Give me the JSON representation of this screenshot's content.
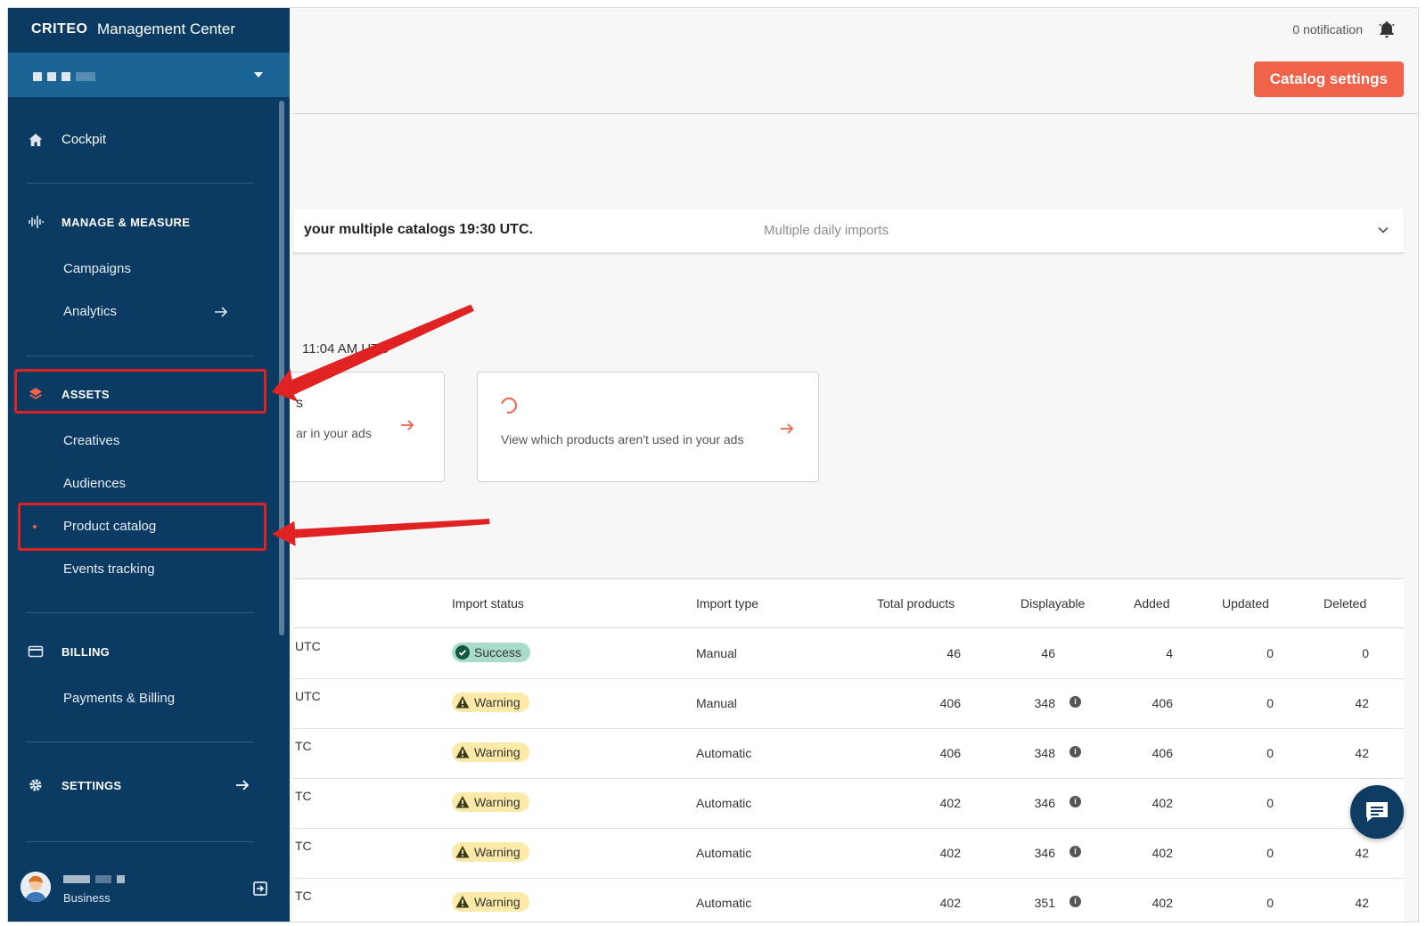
{
  "brand": {
    "logo": "CRITEO",
    "title": "Management Center"
  },
  "header": {
    "notifications": "0 notification",
    "catalog_settings": "Catalog settings"
  },
  "info_bar": {
    "text": "your multiple catalogs 19:30 UTC.",
    "subtext": "Multiple daily imports"
  },
  "time_label": "11:04 AM UTC",
  "cards": [
    {
      "title_fragment": "s",
      "text": "ar in your ads"
    },
    {
      "text": "View which products aren't used in your ads"
    }
  ],
  "sidebar": {
    "cockpit": "Cockpit",
    "manage_measure": "MANAGE & MEASURE",
    "campaigns": "Campaigns",
    "analytics": "Analytics",
    "assets": "ASSETS",
    "creatives": "Creatives",
    "audiences": "Audiences",
    "product_catalog": "Product catalog",
    "events_tracking": "Events tracking",
    "billing": "BILLING",
    "payments_billing": "Payments & Billing",
    "settings": "SETTINGS",
    "user_role": "Business"
  },
  "table": {
    "headers": [
      "Import status",
      "Import type",
      "Total products",
      "Displayable",
      "Added",
      "Updated",
      "Deleted"
    ],
    "rows": [
      {
        "date": "UTC",
        "status": "Success",
        "type": "Manual",
        "total": "46",
        "displayable": "46",
        "added": "4",
        "updated": "0",
        "deleted": "0",
        "info": false
      },
      {
        "date": "UTC",
        "status": "Warning",
        "type": "Manual",
        "total": "406",
        "displayable": "348",
        "added": "406",
        "updated": "0",
        "deleted": "42",
        "info": true
      },
      {
        "date": "TC",
        "status": "Warning",
        "type": "Automatic",
        "total": "406",
        "displayable": "348",
        "added": "406",
        "updated": "0",
        "deleted": "42",
        "info": true
      },
      {
        "date": "TC",
        "status": "Warning",
        "type": "Automatic",
        "total": "402",
        "displayable": "346",
        "added": "402",
        "updated": "0",
        "deleted": "",
        "info": true
      },
      {
        "date": "TC",
        "status": "Warning",
        "type": "Automatic",
        "total": "402",
        "displayable": "346",
        "added": "402",
        "updated": "0",
        "deleted": "42",
        "info": true
      },
      {
        "date": "TC",
        "status": "Warning",
        "type": "Automatic",
        "total": "402",
        "displayable": "351",
        "added": "402",
        "updated": "0",
        "deleted": "42",
        "info": true
      }
    ]
  },
  "colors": {
    "sidebar": "#0b3a63",
    "account_bar": "#1a6496",
    "accent": "#f0624a",
    "annotation": "#e02222",
    "success": "#a9dcc8",
    "warning": "#fdeaa8"
  }
}
